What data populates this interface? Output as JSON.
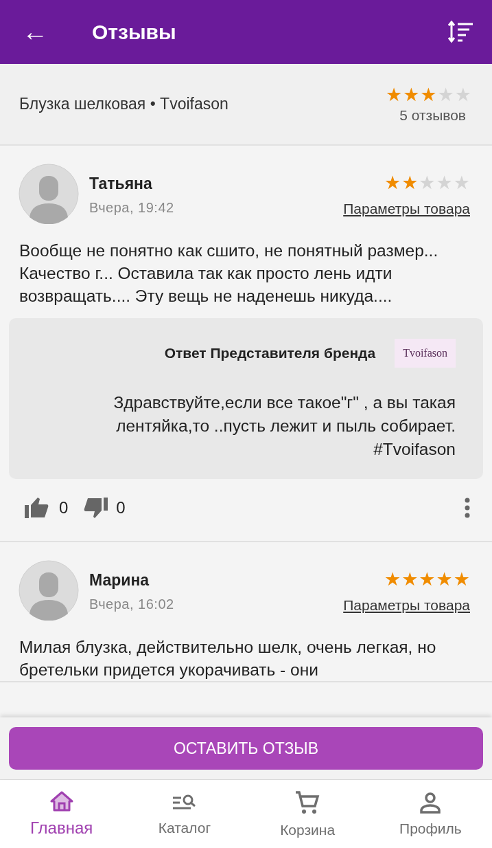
{
  "header": {
    "back": "←",
    "title": "Отзывы"
  },
  "product": {
    "name": "Блузка шелковая • Tvoifason",
    "stars": 3,
    "count": "5 отзывов"
  },
  "reviews": [
    {
      "author": "Татьяна",
      "date": "Вчера, 19:42",
      "stars": 2,
      "params_link": "Параметры товара",
      "text": "Вообще не понятно как сшито, не понятный размер... Качество г... Оставила так как просто лень идти возвращать.... Эту вещь не наденешь никуда....",
      "reply": {
        "title": "Ответ Представителя бренда",
        "brand": "Tvoifason",
        "text": "Здравствуйте,если все такое\"г\" , а вы такая лентяйка,то ..пусть лежит и пыль собирает. #Tvoifason"
      },
      "likes": "0",
      "dislikes": "0"
    },
    {
      "author": "Марина",
      "date": "Вчера, 16:02",
      "stars": 5,
      "params_link": "Параметры товара",
      "text": "Милая блузка, действительно шелк, очень легкая, но бретельки придется укорачивать - они"
    }
  ],
  "action_button": "ОСТАВИТЬ ОТЗЫВ",
  "nav": [
    {
      "label": "Главная",
      "selected": true
    },
    {
      "label": "Каталог",
      "selected": false
    },
    {
      "label": "Корзина",
      "selected": false
    },
    {
      "label": "Профиль",
      "selected": false
    }
  ]
}
